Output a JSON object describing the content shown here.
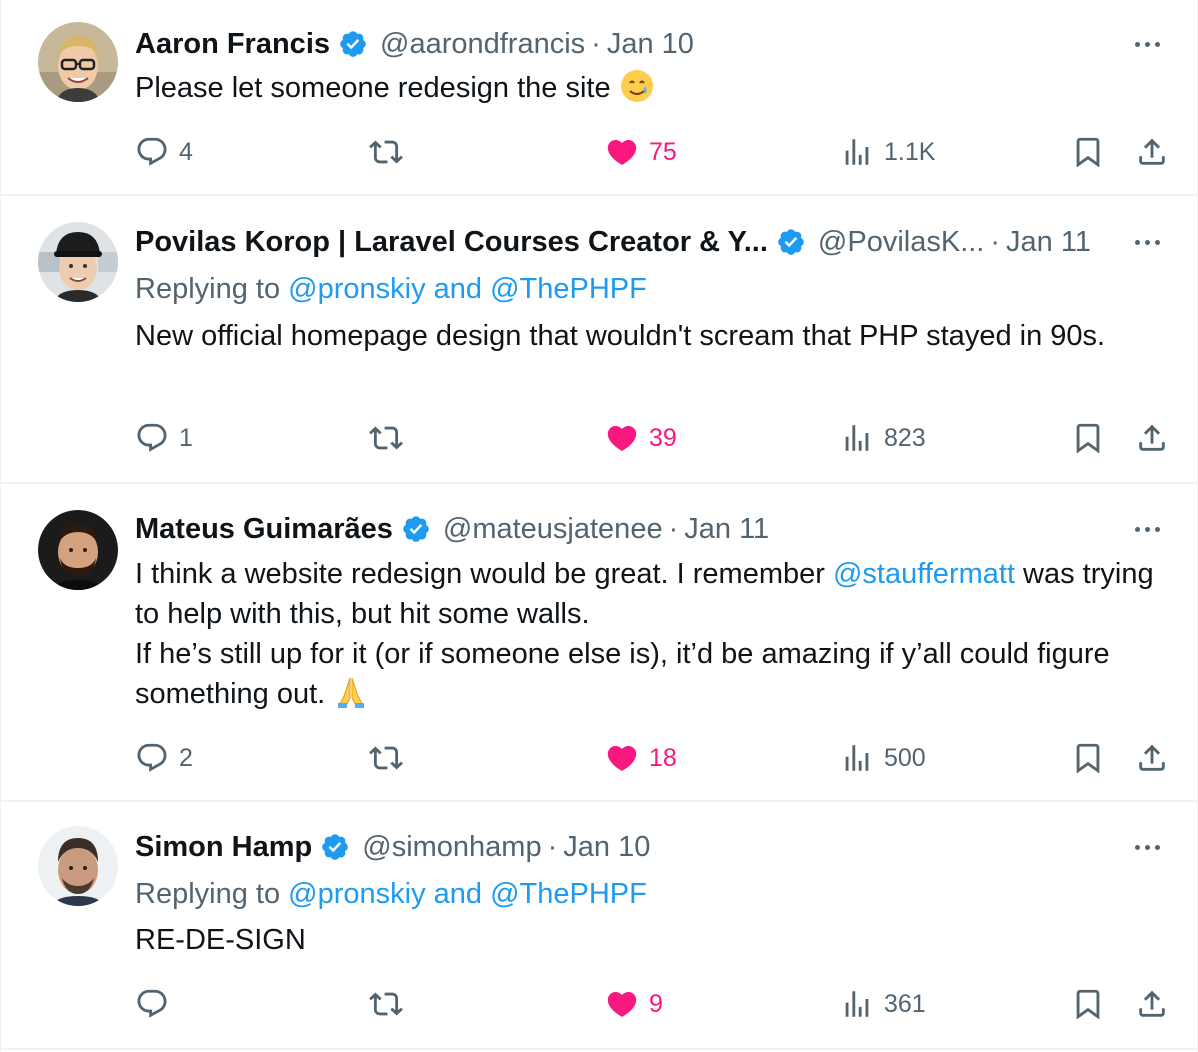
{
  "tweets": [
    {
      "name": "Aaron Francis",
      "handle": "@aarondfrancis",
      "dot": "·",
      "date": "Jan 10",
      "text": "Please let someone redesign the site",
      "emoji": "smiling-face-with-tear",
      "replies": "4",
      "likes": "75",
      "views": "1.1K"
    },
    {
      "name": "Povilas Korop | Laravel Courses Creator & Y...",
      "handle": "@PovilasK...",
      "dot": "·",
      "date": "Jan 11",
      "replying_prefix": "Replying to ",
      "replying_to": "@pronskiy and @ThePHPF",
      "text": "New official homepage design that wouldn't scream that PHP stayed in 90s.",
      "replies": "1",
      "likes": "39",
      "views": "823"
    },
    {
      "name": "Mateus Guimarães",
      "handle": "@mateusjatenee",
      "dot": "·",
      "date": "Jan 11",
      "text_part1": "I think a website redesign would be great. I remember ",
      "mention": "@stauffermatt",
      "text_part2": " was trying to help with this, but hit some walls.",
      "text_line2": "If he’s still up for it (or if someone else is), it’d be amazing if y’all could figure something out.",
      "emoji": "folded-hands",
      "replies": "2",
      "likes": "18",
      "views": "500"
    },
    {
      "name": "Simon Hamp",
      "handle": "@simonhamp",
      "dot": "·",
      "date": "Jan 10",
      "replying_prefix": "Replying to ",
      "replying_to": "@pronskiy and @ThePHPF",
      "text": "RE-DE-SIGN",
      "replies": "",
      "likes": "9",
      "views": "361"
    }
  ],
  "colors": {
    "like": "#f91880",
    "link": "#1d9bf0",
    "muted": "#536471",
    "verified": "#1d9bf0"
  },
  "icons": [
    "reply-icon",
    "retweet-icon",
    "heart-icon",
    "views-icon",
    "bookmark-icon",
    "share-icon",
    "verified-badge-icon",
    "more-icon"
  ]
}
